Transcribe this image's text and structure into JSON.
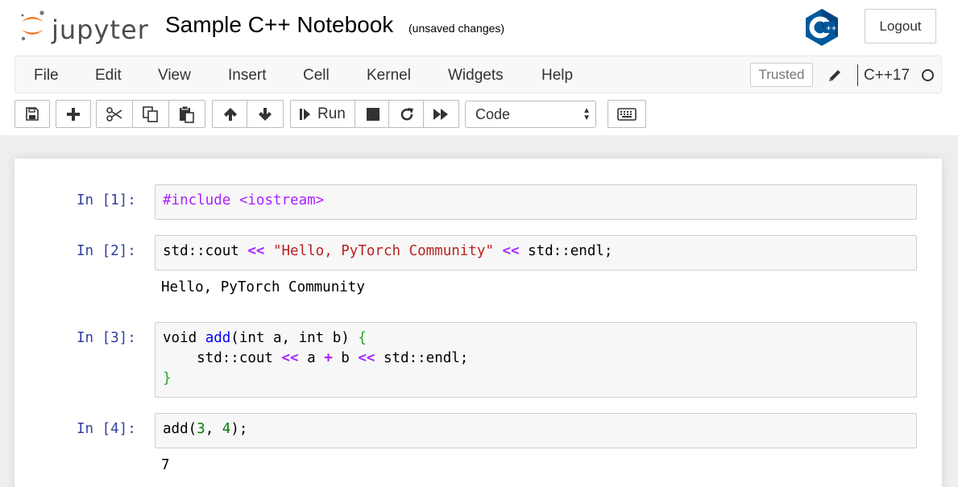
{
  "header": {
    "logo_text": "jupyter",
    "notebook_title": "Sample C++ Notebook",
    "save_status": "(unsaved changes)",
    "logout_label": "Logout",
    "kernel_logo_icon": "cpp-logo-icon"
  },
  "menubar": {
    "items": [
      "File",
      "Edit",
      "View",
      "Insert",
      "Cell",
      "Kernel",
      "Widgets",
      "Help"
    ],
    "trusted_label": "Trusted",
    "kernel_name": "C++17"
  },
  "toolbar": {
    "run_label": "Run",
    "cell_type": "Code",
    "icons": [
      "save-icon",
      "plus-icon",
      "scissors-icon",
      "copy-icon",
      "paste-icon",
      "arrow-up-icon",
      "arrow-down-icon",
      "step-icon",
      "stop-icon",
      "restart-icon",
      "fast-forward-icon",
      "keyboard-icon"
    ]
  },
  "cells": [
    {
      "prompt": "In [1]:",
      "output": ""
    },
    {
      "prompt": "In [2]:",
      "output": "Hello, PyTorch Community"
    },
    {
      "prompt": "In [3]:",
      "output": ""
    },
    {
      "prompt": "In [4]:",
      "output": "7"
    }
  ],
  "code": {
    "c1": {
      "include": "#include <iostream>"
    },
    "c2": {
      "a": "std::cout ",
      "op1": "<<",
      "str": " \"Hello, PyTorch Community\"",
      "op2": " <<",
      "b": " std::endl;"
    },
    "c3": {
      "l1_a": "void ",
      "l1_fn": "add",
      "l1_b": "(int a, int b) ",
      "l1_br": "{",
      "l2_a": "    std::cout ",
      "l2_op1": "<<",
      "l2_b": " a ",
      "l2_op2": "+",
      "l2_c": " b ",
      "l2_op3": "<<",
      "l2_d": " std::endl;",
      "l3_br": "}"
    },
    "c4": {
      "a": "add(",
      "n1": "3",
      "b": ", ",
      "n2": "4",
      "c": ");"
    }
  },
  "colors": {
    "prompt": "#303f9f",
    "operator": "#aa22ff",
    "string": "#ba2121",
    "number": "#008000",
    "kernel_logo": "#00599c"
  }
}
